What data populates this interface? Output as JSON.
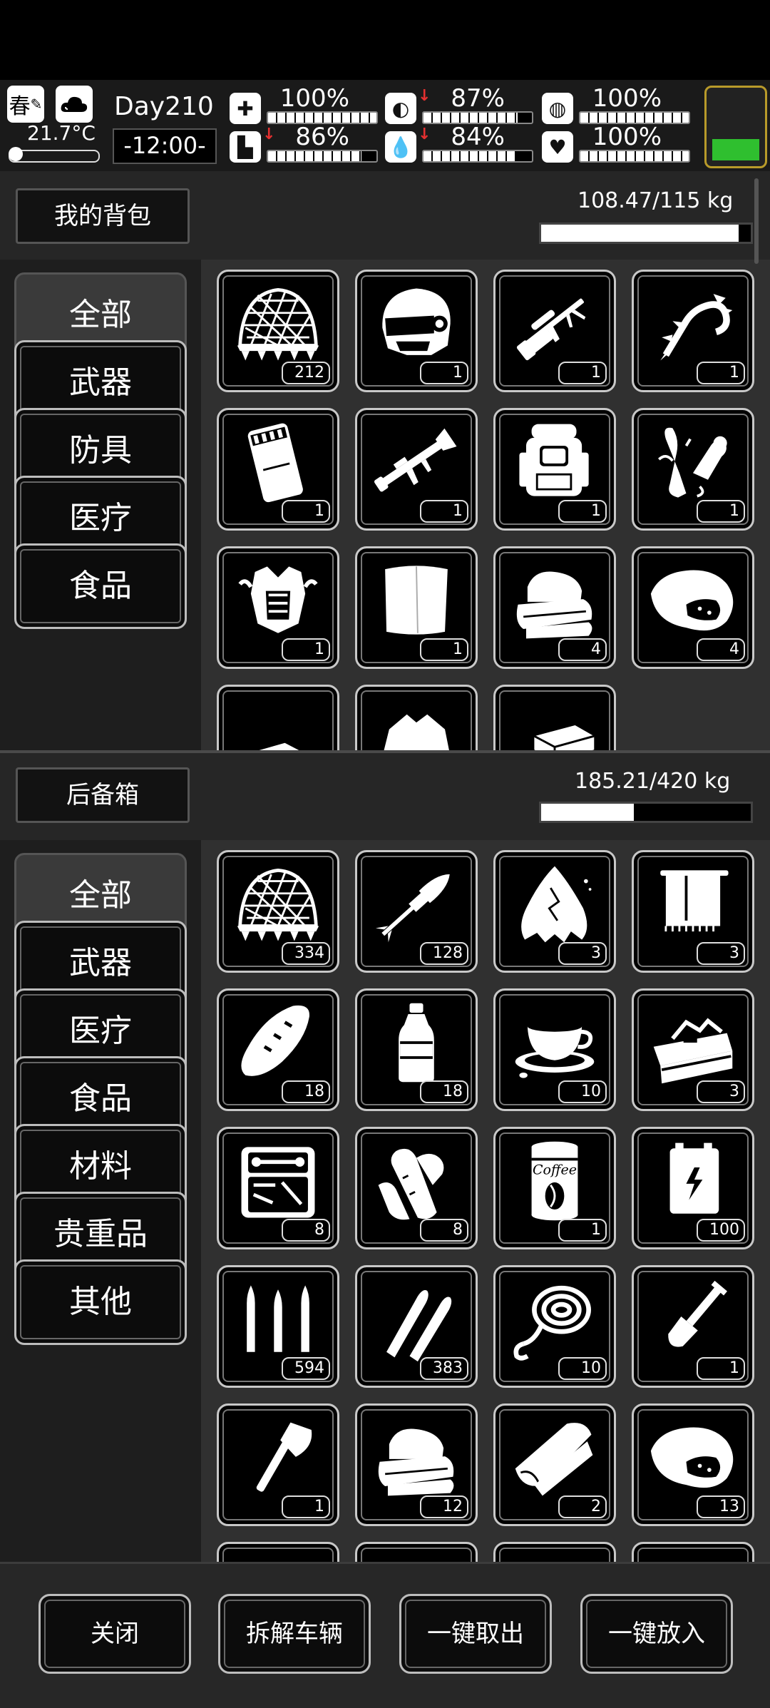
{
  "status": {
    "season": "春",
    "season_icon": "quill-icon",
    "weather_icon": "cloud-icon",
    "temperature": "21.7°C",
    "day": "Day210",
    "time": "-12:00-",
    "stats": [
      {
        "icon": "first-aid-icon",
        "glyph": "✚",
        "percent": "100%",
        "level": 100,
        "warning": false
      },
      {
        "icon": "stomach-icon",
        "glyph": "◐",
        "percent": "87%",
        "level": 87,
        "warning": true
      },
      {
        "icon": "pill-icon",
        "glyph": "◍",
        "percent": "100%",
        "level": 100,
        "warning": false
      },
      {
        "icon": "foot-icon",
        "glyph": "▙",
        "percent": "86%",
        "level": 86,
        "warning": true
      },
      {
        "icon": "water-drop-icon",
        "glyph": "💧",
        "percent": "84%",
        "level": 84,
        "warning": true
      },
      {
        "icon": "heart-icon",
        "glyph": "♥",
        "percent": "100%",
        "level": 100,
        "warning": false
      }
    ],
    "battery_level": 30
  },
  "backpack": {
    "title": "我的背包",
    "weight": "108.47/115 kg",
    "weight_fraction": 0.943,
    "categories": [
      "全部",
      "武器",
      "防具",
      "医疗",
      "食品"
    ],
    "items": [
      {
        "name": "camo-net-icon",
        "qty": "212"
      },
      {
        "name": "combat-helmet-icon",
        "qty": "1"
      },
      {
        "name": "sniper-rifle-icon",
        "qty": "1"
      },
      {
        "name": "chain-whip-icon",
        "qty": "1"
      },
      {
        "name": "ammo-box-icon",
        "qty": "1"
      },
      {
        "name": "rocket-launcher-icon",
        "qty": "1"
      },
      {
        "name": "hiking-backpack-icon",
        "qty": "1"
      },
      {
        "name": "gauntlet-icon",
        "qty": "1"
      },
      {
        "name": "body-armor-icon",
        "qty": "1"
      },
      {
        "name": "cloth-sheet-icon",
        "qty": "1"
      },
      {
        "name": "folded-towels-icon",
        "qty": "4"
      },
      {
        "name": "roast-meat-icon",
        "qty": "4"
      },
      {
        "name": "paper-sheets-icon",
        "qty": ""
      },
      {
        "name": "torn-shirt-icon",
        "qty": ""
      },
      {
        "name": "bricks-icon",
        "qty": ""
      }
    ]
  },
  "storage": {
    "title": "后备箱",
    "weight": "185.21/420 kg",
    "weight_fraction": 0.441,
    "categories": [
      "全部",
      "武器",
      "医疗",
      "食品",
      "材料",
      "贵重品",
      "其他"
    ],
    "items": [
      {
        "name": "camo-net-icon",
        "qty": "334"
      },
      {
        "name": "rpg-rocket-icon",
        "qty": "128"
      },
      {
        "name": "torn-rag-icon",
        "qty": "3"
      },
      {
        "name": "hanging-towel-icon",
        "qty": "3"
      },
      {
        "name": "bread-loaf-icon",
        "qty": "18"
      },
      {
        "name": "water-bottle-icon",
        "qty": "18"
      },
      {
        "name": "coffee-cup-icon",
        "qty": "10"
      },
      {
        "name": "toolbox-icon",
        "qty": "3"
      },
      {
        "name": "repair-kit-icon",
        "qty": "8"
      },
      {
        "name": "bandage-roll-icon",
        "qty": "8"
      },
      {
        "name": "coffee-can-icon",
        "qty": "1",
        "label": "Coffee"
      },
      {
        "name": "battery-cells-icon",
        "qty": "100"
      },
      {
        "name": "rifle-bullets-icon",
        "qty": "594"
      },
      {
        "name": "pistol-bullets-icon",
        "qty": "383"
      },
      {
        "name": "rope-hook-icon",
        "qty": "10"
      },
      {
        "name": "shovel-icon",
        "qty": "1"
      },
      {
        "name": "hatchet-icon",
        "qty": "1"
      },
      {
        "name": "folded-towels-icon",
        "qty": "12"
      },
      {
        "name": "cloth-roll-icon",
        "qty": "2"
      },
      {
        "name": "roast-meat-icon",
        "qty": "13"
      }
    ]
  },
  "footer": {
    "buttons": [
      "关闭",
      "拆解车辆",
      "一键取出",
      "一键放入"
    ]
  }
}
